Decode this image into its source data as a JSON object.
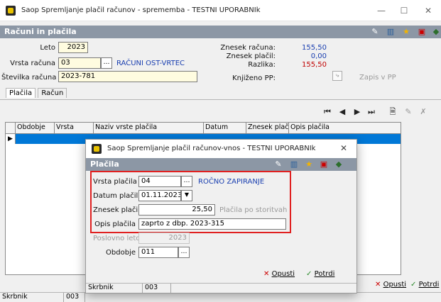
{
  "window": {
    "title": "Saop Spremljanje plačil računov - sprememba - TESTNI UPORABNIk"
  },
  "form": {
    "title": "Računi in plačila"
  },
  "fields": {
    "leto_label": "Leto",
    "leto_value": "2023",
    "vrsta_racuna_label": "Vrsta računa",
    "vrsta_racuna_value": "03",
    "vrsta_racuna_name": "RAČUNI OST-VRTEC",
    "stevilka_label": "Številka računa",
    "stevilka_value": "2023-781"
  },
  "summary": {
    "znesek_racuna_label": "Znesek računa:",
    "znesek_racuna_value": "155,50",
    "znesek_placil_label": "Znesek plačil:",
    "znesek_placil_value": "0,00",
    "razlika_label": "Razlika:",
    "razlika_value": "155,50",
    "knjizeno_label": "Knjiženo PP:",
    "zapis_label": "Zapis v PP"
  },
  "tabs": [
    {
      "label": "Plačila"
    },
    {
      "label": "Račun"
    }
  ],
  "grid": {
    "columns": [
      "Obdobje",
      "Vrsta",
      "Naziv vrste plačila",
      "Datum",
      "Znesek plačila",
      "Opis plačila"
    ]
  },
  "buttons": {
    "opusti": "Opusti",
    "potrdi": "Potrdi"
  },
  "status": {
    "label": "Skrbnik",
    "value": "003"
  },
  "dialog": {
    "title": "Saop Spremljanje plačil računov-vnos - TESTNI UPORABNIk",
    "header": "Plačila",
    "vrsta_placila_label": "Vrsta plačila",
    "vrsta_placila_value": "04",
    "vrsta_placila_name": "ROČNO ZAPIRANJE",
    "datum_label": "Datum plačila",
    "datum_value": "01.11.2023",
    "znesek_label": "Znesek plačila",
    "znesek_value": "25,50",
    "placila_po_storitvah": "Plačila po storitvah",
    "opis_label": "Opis plačila",
    "opis_value": "zaprto z dbp. 2023-315",
    "poslovno_leto_label": "Poslovno leto",
    "poslovno_leto_value": "2023",
    "obdobje_label": "Obdobje",
    "obdobje_value": "011",
    "opusti": "Opusti",
    "potrdi": "Potrdi",
    "status_label": "Skrbnik",
    "status_value": "003"
  },
  "colors": {
    "header": "#8c97a5",
    "selection": "#0078d7",
    "highlight": "#e02020",
    "blue_text": "#1a3fb0",
    "red_text": "#c00000"
  }
}
